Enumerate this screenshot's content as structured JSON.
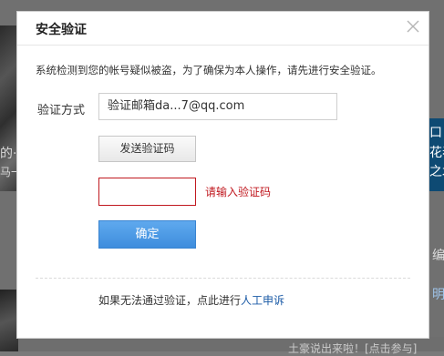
{
  "background": {
    "left_text_1": "的·",
    "left_text_2": "马一",
    "right_text_1": "口",
    "right_text_2": "花春",
    "right_text_3": "之北",
    "right_text_4": "编",
    "right_text_5": "明星",
    "bottom_text": "土豪说出来啦！[点击参与]"
  },
  "dialog": {
    "title": "安全验证",
    "notice": "系统检测到您的帐号疑似被盗，为了确保为本人操作，请先进行安全验证。",
    "method_label": "验证方式",
    "method_value": "验证邮箱da...7@qq.com",
    "send_button": "发送验证码",
    "code_input_value": "",
    "code_error": "请输入验证码",
    "confirm_button": "确定",
    "footer_prefix": "如果无法通过验证，点此进行",
    "footer_link": "人工申诉"
  },
  "colors": {
    "error": "#c0181f",
    "primary": "#3e8ddd",
    "link": "#1a5aa6"
  }
}
